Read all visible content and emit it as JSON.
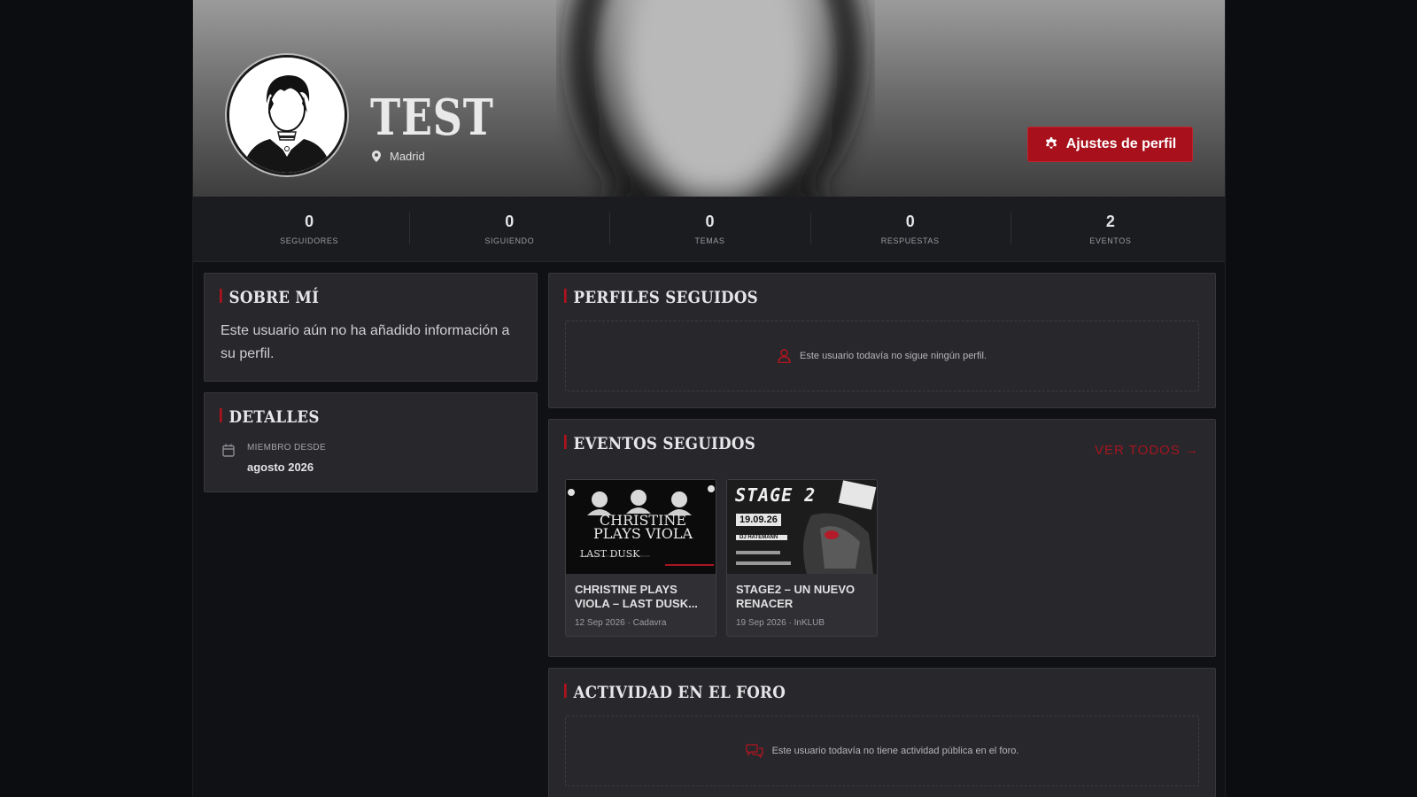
{
  "profile": {
    "username": "TEST",
    "location": "Madrid",
    "settings_label": "Ajustes de perfil"
  },
  "stats": [
    {
      "value": "0",
      "label": "SEGUIDORES"
    },
    {
      "value": "0",
      "label": "SIGUIENDO"
    },
    {
      "value": "0",
      "label": "TEMAS"
    },
    {
      "value": "0",
      "label": "RESPUESTAS"
    },
    {
      "value": "2",
      "label": "EVENTOS"
    }
  ],
  "about": {
    "title": "SOBRE MÍ",
    "text": "Este usuario aún no ha añadido información a su perfil."
  },
  "details": {
    "title": "DETALLES",
    "member_since_label": "MIEMBRO DESDE",
    "member_since_value": "agosto 2026"
  },
  "followed_profiles": {
    "title": "PERFILES SEGUIDOS",
    "empty": "Este usuario todavía no sigue ningún perfil."
  },
  "followed_events": {
    "title": "EVENTOS SEGUIDOS",
    "view_all": "VER TODOS →",
    "events": [
      {
        "title": "CHRISTINE PLAYS VIOLA – LAST DUSK...",
        "meta": "12 Sep 2026 · Cadavra",
        "poster_text": "CHRISTINE PLAYS VIOLA",
        "poster_sub": "LAST DUSK"
      },
      {
        "title": "STAGE2 – UN NUEVO RENACER",
        "meta": "19 Sep 2026 · InKLUB",
        "poster_text": "STAGE 2",
        "poster_date": "19.09.26",
        "poster_sub": "DJ HATEMANN"
      }
    ]
  },
  "forum": {
    "title": "ACTIVIDAD EN EL FORO",
    "empty": "Este usuario todavía no tiene actividad pública en el foro."
  },
  "colors": {
    "accent": "#a8101c",
    "background": "#0c0d10",
    "card": "#28282c"
  }
}
